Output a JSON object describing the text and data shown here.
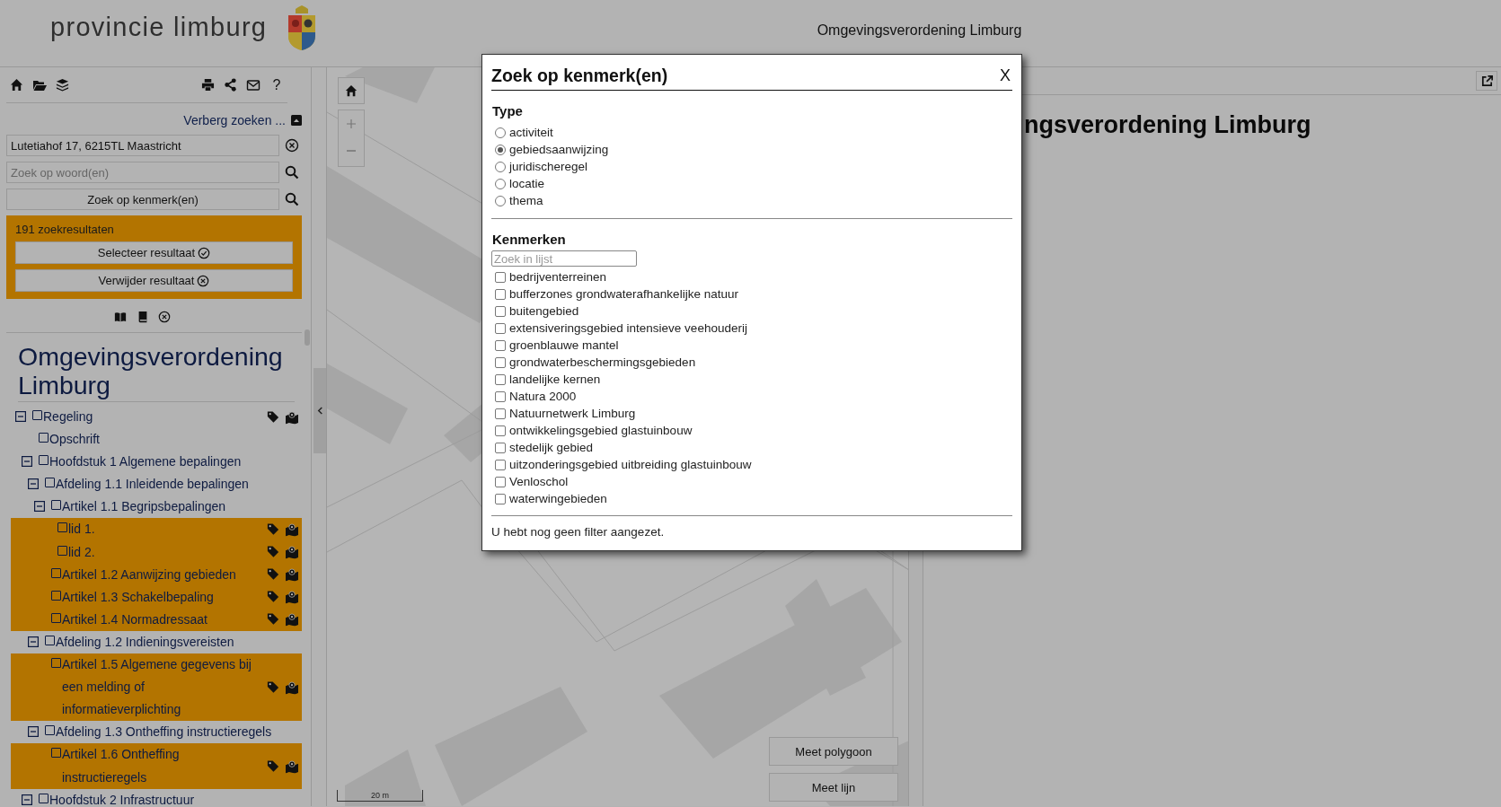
{
  "header": {
    "logo_text": "provincie limburg",
    "title": "Omgevingsverordening Limburg"
  },
  "sidebar": {
    "help_label": "?",
    "hide_search_link": "Verberg zoeken ...",
    "address_field": {
      "value": "Lutetiahof 17, 6215TL Maastricht"
    },
    "word_search": {
      "placeholder": "Zoek op woord(en)"
    },
    "feature_search_button": "Zoek op kenmerk(en)",
    "results": {
      "count_text": "191 zoekresultaten",
      "buttons": [
        {
          "label": "Selecteer resultaat",
          "kind": "select"
        },
        {
          "label": "Verwijder resultaat",
          "kind": "remove"
        }
      ]
    },
    "tree_title": "Omgevingsverordening Limburg",
    "tree": [
      {
        "label": "Regeling",
        "kind": "branch",
        "expanded": true,
        "checked": false,
        "highlighted": false,
        "actions": true,
        "children": [
          {
            "label": "Opschrift",
            "kind": "leaf",
            "checked": false,
            "highlighted": false,
            "actions": false
          },
          {
            "label": "Hoofdstuk 1 Algemene bepalingen",
            "kind": "branch",
            "expanded": true,
            "checked": false,
            "highlighted": false,
            "actions": false,
            "children": [
              {
                "label": "Afdeling 1.1 Inleidende bepalingen",
                "kind": "branch",
                "expanded": true,
                "checked": false,
                "highlighted": false,
                "actions": false,
                "children": [
                  {
                    "label": "Artikel 1.1 Begripsbepalingen",
                    "kind": "branch",
                    "expanded": true,
                    "checked": false,
                    "highlighted": false,
                    "actions": false,
                    "children": [
                      {
                        "label": "lid 1.",
                        "kind": "leaf",
                        "checked": false,
                        "highlighted": true,
                        "actions": true
                      },
                      {
                        "label": "lid 2.",
                        "kind": "leaf",
                        "checked": false,
                        "highlighted": true,
                        "actions": true
                      }
                    ]
                  },
                  {
                    "label": "Artikel 1.2 Aanwijzing gebieden",
                    "kind": "leaf",
                    "checked": false,
                    "highlighted": true,
                    "actions": true
                  },
                  {
                    "label": "Artikel 1.3 Schakelbepaling",
                    "kind": "leaf",
                    "checked": false,
                    "highlighted": true,
                    "actions": true
                  },
                  {
                    "label": "Artikel 1.4 Normadressaat",
                    "kind": "leaf",
                    "checked": false,
                    "highlighted": true,
                    "actions": true
                  }
                ]
              },
              {
                "label": "Afdeling 1.2 Indieningsvereisten",
                "kind": "branch",
                "expanded": true,
                "checked": false,
                "highlighted": false,
                "actions": false,
                "children": [
                  {
                    "label": "Artikel 1.5 Algemene gegevens bij een melding of informatieverplichting",
                    "kind": "leaf",
                    "checked": false,
                    "highlighted": true,
                    "actions": true
                  }
                ]
              },
              {
                "label": "Afdeling 1.3 Ontheffing instructieregels",
                "kind": "branch",
                "expanded": true,
                "checked": false,
                "highlighted": false,
                "actions": false,
                "children": [
                  {
                    "label": "Artikel 1.6 Ontheffing instructieregels",
                    "kind": "leaf",
                    "checked": false,
                    "highlighted": true,
                    "actions": true
                  }
                ]
              }
            ]
          },
          {
            "label": "Hoofdstuk 2 Infrastructuur",
            "kind": "branch",
            "expanded": true,
            "checked": false,
            "highlighted": false,
            "actions": false
          }
        ]
      }
    ]
  },
  "map": {
    "kind": "picture",
    "scale_label": "20 m",
    "buttons": [
      "Meet polygoon",
      "Meet lijn"
    ]
  },
  "document": {
    "title": "ngsverordening Limburg"
  },
  "dialog": {
    "title": "Zoek op kenmerk(en)",
    "close": "X",
    "type_heading": "Type",
    "types": [
      {
        "label": "activiteit",
        "selected": false
      },
      {
        "label": "gebiedsaanwijzing",
        "selected": true
      },
      {
        "label": "juridischeregel",
        "selected": false
      },
      {
        "label": "locatie",
        "selected": false
      },
      {
        "label": "thema",
        "selected": false
      }
    ],
    "features_heading": "Kenmerken",
    "filter": {
      "placeholder": "Zoek in lijst"
    },
    "features": [
      {
        "label": "bedrijventerreinen",
        "checked": false
      },
      {
        "label": "bufferzones grondwaterafhankelijke natuur",
        "checked": false
      },
      {
        "label": "buitengebied",
        "checked": false
      },
      {
        "label": "extensiveringsgebied intensieve veehouderij",
        "checked": false
      },
      {
        "label": "groenblauwe mantel",
        "checked": false
      },
      {
        "label": "grondwaterbeschermingsgebieden",
        "checked": false
      },
      {
        "label": "landelijke kernen",
        "checked": false
      },
      {
        "label": "Natura 2000",
        "checked": false
      },
      {
        "label": "Natuurnetwerk Limburg",
        "checked": false
      },
      {
        "label": "ontwikkelingsgebied glastuinbouw",
        "checked": false
      },
      {
        "label": "stedelijk gebied",
        "checked": false
      },
      {
        "label": "uitzonderingsgebied uitbreiding glastuinbouw",
        "checked": false
      },
      {
        "label": "Venloschol",
        "checked": false
      },
      {
        "label": "waterwingebieden",
        "checked": false
      }
    ],
    "status": "U hebt nog geen filter aangezet."
  }
}
